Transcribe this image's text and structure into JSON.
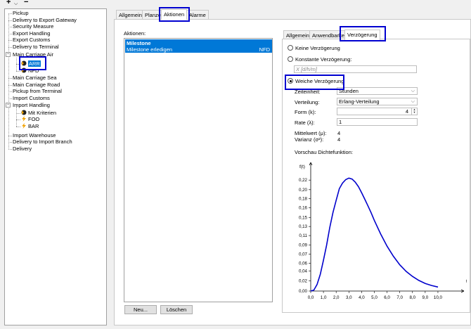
{
  "toolbar": {
    "add_icon": "+",
    "add_dropdown": "⌵",
    "remove_icon": "−"
  },
  "tree": [
    {
      "label": "Pickup"
    },
    {
      "label": "Delivery to Export Gateway"
    },
    {
      "label": "Security Measure"
    },
    {
      "label": "Export Handling"
    },
    {
      "label": "Export Customs"
    },
    {
      "label": "Delivery to Terminal"
    },
    {
      "label": "Main Carriage Air"
    },
    {
      "label": "ARR"
    },
    {
      "label": "NFD"
    },
    {
      "label": "Main Carriage Sea"
    },
    {
      "label": "Main Carriage Road"
    },
    {
      "label": "Pickup from Terminal"
    },
    {
      "label": "Import Customs"
    },
    {
      "label": "Import Handling"
    },
    {
      "label": "Mit Kriterien"
    },
    {
      "label": "FOO"
    },
    {
      "label": "BAR"
    },
    {
      "label": "Import Warehouse"
    },
    {
      "label": "Delivery to Import Branch"
    },
    {
      "label": "Delivery"
    }
  ],
  "main_tabs": [
    "Allgemein",
    "Planzeit",
    "Aktionen",
    "Alarme"
  ],
  "actions": {
    "title": "Aktionen:",
    "row_title": "Milestone",
    "row_desc": "Milestone erledigen",
    "row_code": "NFD",
    "new_button": "Neu...",
    "delete_button": "Löschen"
  },
  "detail_tabs": [
    "Allgemein",
    "Anwendbarkeit",
    "Verzögerung"
  ],
  "delay": {
    "none_label": "Keine Verzögerung",
    "constant_label": "Konstante Verzögerung:",
    "constant_placeholder": "X [d/h/m]",
    "soft_label": "Weiche Verzögerung",
    "unit_label": "Zeiteinheit:",
    "unit_value": "Stunden",
    "distribution_label": "Verteilung:",
    "distribution_value": "Erlang-Verteilung",
    "shape_label": "Form (k):",
    "shape_value": "4",
    "rate_label": "Rate (λ):",
    "rate_value": "1",
    "mean_label": "Mittelwert (μ):",
    "mean_value": "4",
    "variance_label": "Varianz (σ²):",
    "variance_value": "4",
    "preview_label": "Vorschau Dichtefunktion:"
  },
  "chart_data": {
    "type": "line",
    "ylabel": "f(t)",
    "xlabel": "t",
    "xlim": [
      0,
      10.5
    ],
    "ylim": [
      0,
      0.23
    ],
    "x_ticks": [
      "0,0",
      "1,0",
      "2,0",
      "3,0",
      "4,0",
      "5,0",
      "6,0",
      "7,0",
      "8,0",
      "9,0",
      "10,0"
    ],
    "y_ticks": [
      "0,00",
      "0,02",
      "0,04",
      "0,06",
      "0,07",
      "0,09",
      "0,11",
      "0,13",
      "0,15",
      "0,16",
      "0,18",
      "0,20",
      "0,22"
    ],
    "y_tick_values": [
      0.0,
      0.02,
      0.04,
      0.055,
      0.073,
      0.091,
      0.11,
      0.128,
      0.146,
      0.165,
      0.183,
      0.201,
      0.22
    ],
    "series": [
      {
        "color": "#0000cc",
        "x": [
          0,
          0.25,
          0.5,
          0.75,
          1,
          1.25,
          1.5,
          1.75,
          2,
          2.25,
          2.5,
          2.75,
          3,
          3.25,
          3.5,
          3.75,
          4,
          4.25,
          4.5,
          4.75,
          5,
          5.5,
          6,
          6.5,
          7,
          7.5,
          8,
          8.5,
          9,
          9.5,
          10
        ],
        "y": [
          0,
          0.002,
          0.013,
          0.033,
          0.061,
          0.091,
          0.126,
          0.156,
          0.18,
          0.203,
          0.214,
          0.221,
          0.224,
          0.222,
          0.216,
          0.207,
          0.195,
          0.182,
          0.169,
          0.155,
          0.14,
          0.113,
          0.089,
          0.069,
          0.052,
          0.039,
          0.029,
          0.021,
          0.015,
          0.011,
          0.008
        ]
      }
    ]
  },
  "colors": {
    "accent": "#0078d7",
    "highlight_box": "#0000d0",
    "curve": "#0000cc"
  }
}
